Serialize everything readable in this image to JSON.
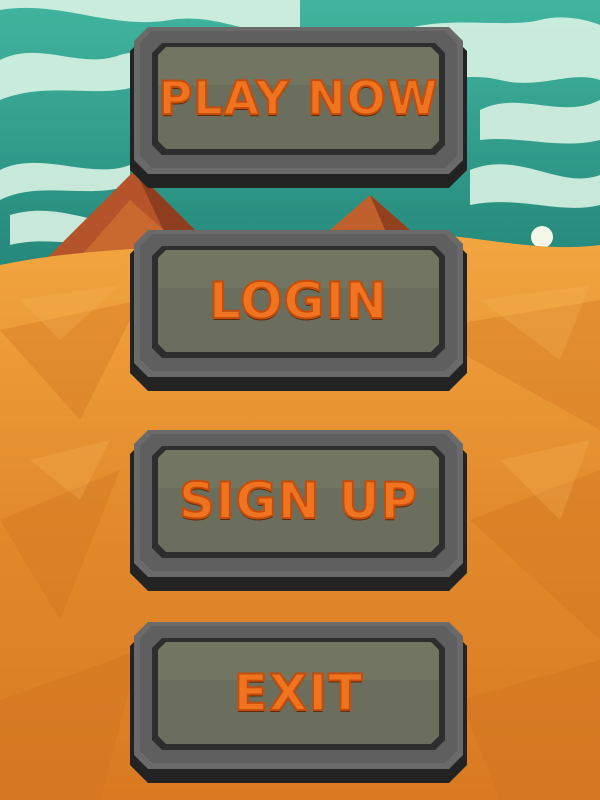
{
  "menu": {
    "play_label": "PLAY NOW",
    "login_label": "LOGIN",
    "signup_label": "SIGN UP",
    "exit_label": "EXIT"
  },
  "colors": {
    "sky": "#2f9a86",
    "cloud": "#cdeede",
    "sand": "#e58a2b",
    "pyramid": "#c0602c",
    "stone": "#5b5b5b",
    "stone_inner": "#6b6e5c",
    "label_orange": "#f0741f"
  }
}
